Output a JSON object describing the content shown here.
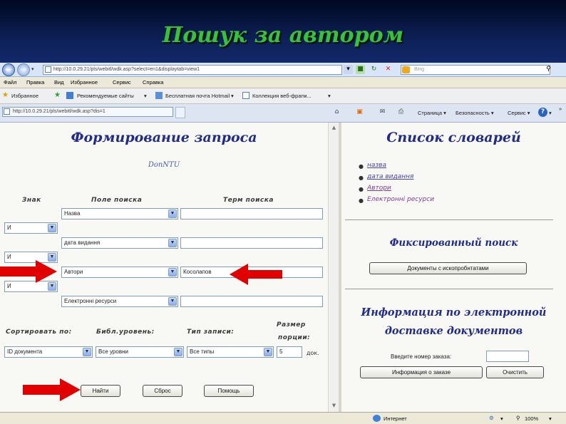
{
  "slide": {
    "title": "Пошук за автором"
  },
  "browser": {
    "menu": [
      "Файл",
      "Правка",
      "Вид",
      "Избранное",
      "Сервис",
      "Справка"
    ],
    "address": "http://10.0.29.21/pls/webitl/wdk.asp?select=en1&displaytab=view1",
    "search_placeholder": "Bing",
    "favorites_label": "Избранное",
    "favorites": [
      "Рекомендуемые сайты",
      "Бесплатная почта Hotmail",
      "Коллекция веб-фрагм..."
    ],
    "tab_address": "http://10.0.29.21/pls/webitl/wdk.asp?dis=1",
    "toolbar": {
      "page": "Страница",
      "safety": "Безопасность",
      "tools": "Сервис"
    },
    "status": {
      "zone": "Интернет",
      "zoom": "100%"
    }
  },
  "query_form": {
    "heading": "Формирование запроса",
    "subheading": "DonNTU",
    "col_sign": "Знак",
    "col_field": "Поле поиска",
    "col_term": "Терм поиска",
    "rows": [
      {
        "sign": "",
        "field": "Назва",
        "term": ""
      },
      {
        "sign": "И",
        "field": "дата видання",
        "term": ""
      },
      {
        "sign": "И",
        "field": "Автори",
        "term": "Косолапов"
      },
      {
        "sign": "И",
        "field": "Електронні ресурси",
        "term": ""
      }
    ],
    "sort_label": "Сортировать по:",
    "level_label": "Библ.уровень:",
    "type_label": "Тип записи:",
    "portion_label_1": "Размер",
    "portion_label_2": "порции:",
    "sort_value": "ID документа",
    "level_value": "Все уровни",
    "type_value": "Все типы",
    "portion_value": "5",
    "portion_unit": "док.",
    "find_button": "Найти",
    "reset_button": "Сброс",
    "help_button": "Помощь"
  },
  "right_panel": {
    "dict_heading": "Список словарей",
    "dicts": [
      "назва",
      "дата видання",
      "Автори",
      "Електронні ресурси"
    ],
    "fixed_heading": "Фиксированный поиск",
    "fixed_button": "Документы с ископробнтатами",
    "info_heading_1": "Информация по электронной",
    "info_heading_2": "доставке документов",
    "order_label": "Введите номер заказа:",
    "order_value": "",
    "info_button": "Информация о заказе",
    "clear_button": "Очистить"
  },
  "colors": {
    "title": "#37c23a",
    "heading": "#1f2b8f",
    "arrow": "#e00000"
  }
}
